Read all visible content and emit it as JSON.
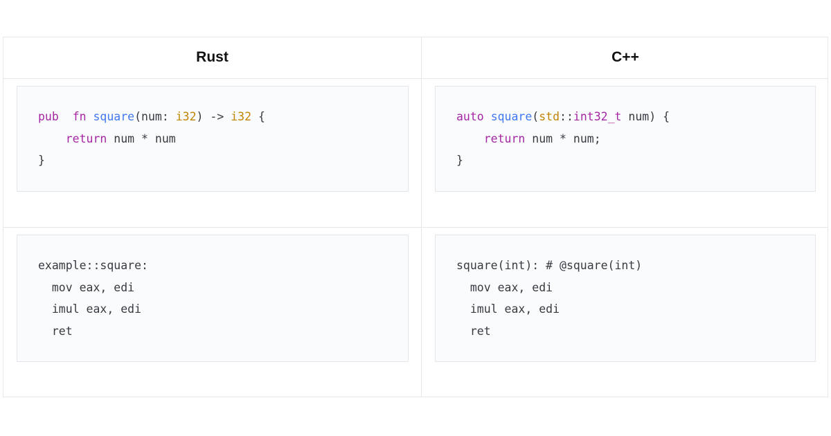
{
  "columns": [
    "Rust",
    "C++"
  ],
  "rows": [
    {
      "rust": [
        [
          [
            "kw",
            "pub"
          ],
          [
            "",
            "  "
          ],
          [
            "kw",
            "fn"
          ],
          [
            "",
            " "
          ],
          [
            "fn",
            "square"
          ],
          [
            "",
            "(num: "
          ],
          [
            "ty",
            "i32"
          ],
          [
            "",
            ") -> "
          ],
          [
            "ty",
            "i32"
          ],
          [
            "",
            " {"
          ]
        ],
        [
          [
            "",
            "    "
          ],
          [
            "kw",
            "return"
          ],
          [
            "",
            " num * num"
          ]
        ],
        [
          [
            "",
            "}"
          ]
        ]
      ],
      "cpp": [
        [
          [
            "kw",
            "auto"
          ],
          [
            "",
            " "
          ],
          [
            "fn",
            "square"
          ],
          [
            "",
            "("
          ],
          [
            "ns",
            "std"
          ],
          [
            "",
            "::"
          ],
          [
            "kw",
            "int32_t"
          ],
          [
            "",
            " num) {"
          ]
        ],
        [
          [
            "",
            "    "
          ],
          [
            "kw",
            "return"
          ],
          [
            "",
            " num * num;"
          ]
        ],
        [
          [
            "",
            "}"
          ]
        ]
      ]
    },
    {
      "rust": [
        [
          [
            "",
            "example::square:"
          ]
        ],
        [
          [
            "",
            "  mov eax, edi"
          ]
        ],
        [
          [
            "",
            "  imul eax, edi"
          ]
        ],
        [
          [
            "",
            "  ret"
          ]
        ]
      ],
      "cpp": [
        [
          [
            "",
            "square(int): # @square(int)"
          ]
        ],
        [
          [
            "",
            "  mov eax, edi"
          ]
        ],
        [
          [
            "",
            "  imul eax, edi"
          ]
        ],
        [
          [
            "",
            "  ret"
          ]
        ]
      ]
    }
  ],
  "colors": {
    "keyword": "#a626a4",
    "function": "#4078f2",
    "type": "#c18401",
    "text": "#383a42"
  }
}
